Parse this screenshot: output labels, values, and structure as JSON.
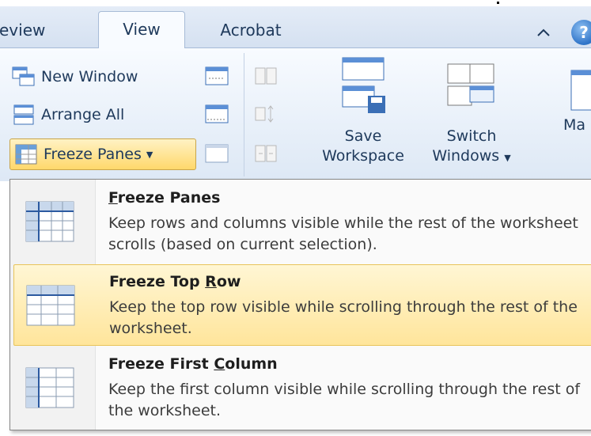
{
  "tabs": {
    "review": "Review",
    "view": "View",
    "acrobat": "Acrobat",
    "help": "?"
  },
  "ribbon": {
    "new_window": "New Window",
    "arrange_all": "Arrange All",
    "freeze_panes": "Freeze Panes",
    "save_workspace_line1": "Save",
    "save_workspace_line2": "Workspace",
    "switch_windows_line1": "Switch",
    "switch_windows_line2": "Windows",
    "macros_partial": "Ma"
  },
  "menu": {
    "items": [
      {
        "title_pre": "",
        "title_ul": "F",
        "title_post": "reeze Panes",
        "desc": "Keep rows and columns visible while the rest of the worksheet scrolls (based on current selection)."
      },
      {
        "title_pre": "Freeze Top ",
        "title_ul": "R",
        "title_post": "ow",
        "desc": "Keep the top row visible while scrolling through the rest of the worksheet.",
        "highlighted": true
      },
      {
        "title_pre": "Freeze First ",
        "title_ul": "C",
        "title_post": "olumn",
        "desc": "Keep the first column visible while scrolling through the rest of the worksheet."
      }
    ]
  },
  "colors": {
    "ribbon_text": "#1e395b",
    "highlight_top": "#fff6d4",
    "highlight_bottom": "#ffe59b",
    "highlight_border": "#e8c45a"
  },
  "icons": {
    "collapse": "caret-up-icon",
    "help": "help-icon",
    "new_window": "new-window-icon",
    "arrange_all": "arrange-all-icon",
    "freeze_panes": "freeze-panes-icon"
  }
}
